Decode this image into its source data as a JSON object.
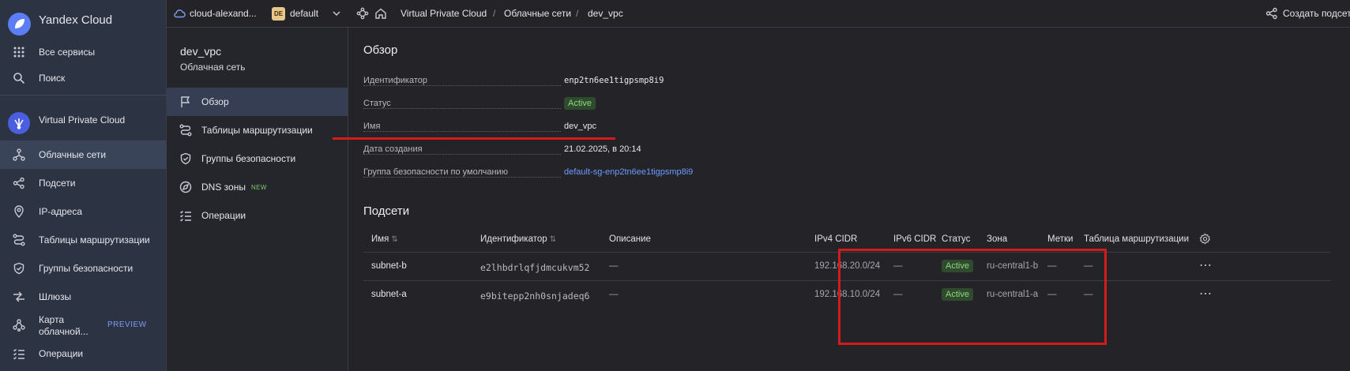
{
  "sidebar": {
    "brand": "Yandex Cloud",
    "all_services": "Все сервисы",
    "search": "Поиск",
    "service": "Virtual Private Cloud",
    "items": [
      {
        "label": "Облачные сети",
        "icon": "cloud-networks-icon"
      },
      {
        "label": "Подсети",
        "icon": "subnets-icon"
      },
      {
        "label": "IP-адреса",
        "icon": "ip-address-icon"
      },
      {
        "label": "Таблицы маршрутизации",
        "icon": "route-tables-icon"
      },
      {
        "label": "Группы безопасности",
        "icon": "shield-icon"
      },
      {
        "label": "Шлюзы",
        "icon": "gateways-icon"
      },
      {
        "label": "Карта облачной...",
        "icon": "map-icon",
        "badge": "PREVIEW"
      },
      {
        "label": "Операции",
        "icon": "operations-icon"
      }
    ]
  },
  "topbar": {
    "cloud": "cloud-alexand...",
    "folder_badge": "DE",
    "folder": "default",
    "breadcrumbs": [
      "Virtual Private Cloud",
      "Облачные сети",
      "dev_vpc"
    ],
    "create_label": "Создать подсет"
  },
  "panel": {
    "title": "dev_vpc",
    "subtitle": "Облачная сеть",
    "items": [
      {
        "label": "Обзор",
        "icon": "flag-icon"
      },
      {
        "label": "Таблицы маршрутизации",
        "icon": "route-tables-icon"
      },
      {
        "label": "Группы безопасности",
        "icon": "shield-icon"
      },
      {
        "label": "DNS зоны",
        "icon": "dns-icon",
        "badge": "NEW"
      },
      {
        "label": "Операции",
        "icon": "operations-icon"
      }
    ]
  },
  "overview": {
    "title": "Обзор",
    "fields": [
      {
        "key": "Идентификатор",
        "value": "enp2tn6ee1tigpsmp8i9"
      },
      {
        "key": "Статус",
        "value": "Active"
      },
      {
        "key": "Имя",
        "value": "dev_vpc"
      },
      {
        "key": "Дата создания",
        "value": "21.02.2025, в 20:14"
      },
      {
        "key": "Группа безопасности по умолчанию",
        "value": "default-sg-enp2tn6ee1tigpsmp8i9"
      }
    ]
  },
  "subnets": {
    "title": "Подсети",
    "columns": [
      "Имя",
      "Идентификатор",
      "Описание",
      "IPv4 CIDR",
      "IPv6 CIDR",
      "Статус",
      "Зона",
      "Метки",
      "Таблица маршрутизации"
    ],
    "rows": [
      {
        "name": "subnet-b",
        "id": "e2lhbdrlqfjdmcukvm52",
        "description": "—",
        "ipv4": "192.168.20.0/24",
        "ipv6": "—",
        "status": "Active",
        "zone": "ru-central1-b",
        "labels": "—",
        "route_table": "—"
      },
      {
        "name": "subnet-a",
        "id": "e9bitepp2nh0snjadeq6",
        "description": "—",
        "ipv4": "192.168.10.0/24",
        "ipv6": "—",
        "status": "Active",
        "zone": "ru-central1-a",
        "labels": "—",
        "route_table": "—"
      }
    ]
  },
  "colors": {
    "sidebar_bg": "#2c3444",
    "active_status": "#8ed77a",
    "link": "#6c9cff",
    "highlight": "#d31b1b"
  }
}
